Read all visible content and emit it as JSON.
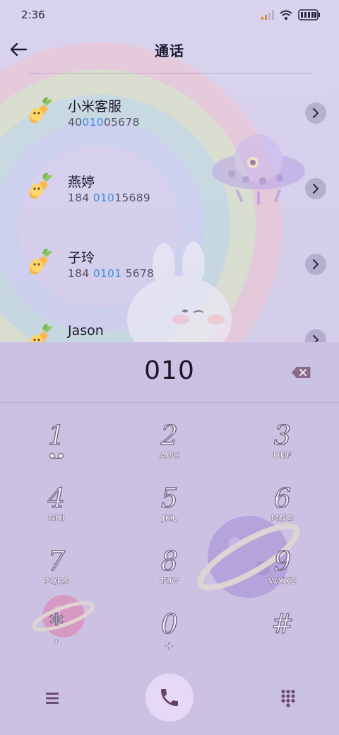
{
  "status_bar": {
    "time": "2:36"
  },
  "header": {
    "title": "通话"
  },
  "contacts": [
    {
      "name": "小米客服",
      "number_pre": "40",
      "number_hl": "010",
      "number_post": "05678"
    },
    {
      "name": "燕婷",
      "number_pre": "184 ",
      "number_hl": "010",
      "number_post": "15689"
    },
    {
      "name": "子玲",
      "number_pre": "184 ",
      "number_hl": "0101",
      "number_post": " 5678"
    },
    {
      "name": "Jason",
      "number_pre": "",
      "number_hl": "",
      "number_post": ""
    }
  ],
  "dialer": {
    "dialed_number": "010"
  },
  "keypad": {
    "keys": [
      {
        "digit": "1",
        "letters": ""
      },
      {
        "digit": "2",
        "letters": "ABC"
      },
      {
        "digit": "3",
        "letters": "DEF"
      },
      {
        "digit": "4",
        "letters": "GHI"
      },
      {
        "digit": "5",
        "letters": "JKL"
      },
      {
        "digit": "6",
        "letters": "MNO"
      },
      {
        "digit": "7",
        "letters": "PQRS"
      },
      {
        "digit": "8",
        "letters": "TUV"
      },
      {
        "digit": "9",
        "letters": "WXYZ"
      },
      {
        "digit": "*",
        "letters": ","
      },
      {
        "digit": "0",
        "letters": "+"
      },
      {
        "digit": "#",
        "letters": ""
      }
    ]
  },
  "icons": {
    "signal": "signal-icon",
    "wifi": "wifi-icon",
    "battery": "battery-icon",
    "back": "arrow-left-icon",
    "avatar": "carrot-avatar-icon",
    "chevron": "chevron-right-icon",
    "backspace": "backspace-icon",
    "voicemail": "voicemail-icon",
    "menu": "menu-icon",
    "call": "phone-icon",
    "dialpad": "dialpad-icon"
  },
  "colors": {
    "highlight": "#3d8ee0",
    "call_button": "#e6d9f5",
    "background": "#cfc7e6"
  }
}
